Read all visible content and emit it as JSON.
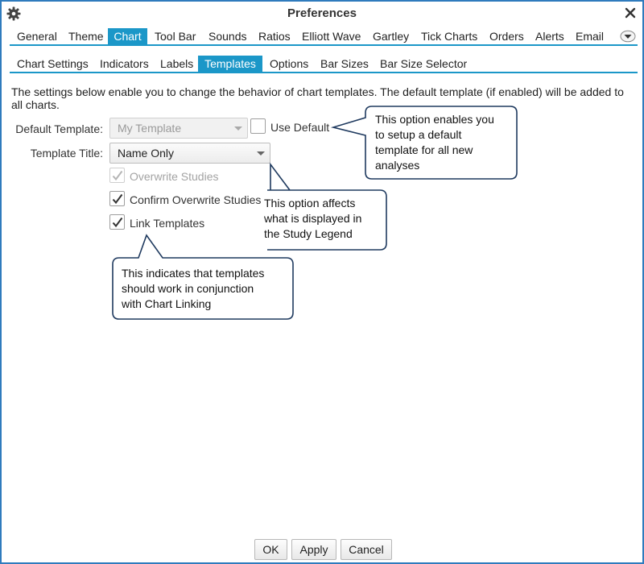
{
  "window": {
    "title": "Preferences"
  },
  "icons": {
    "settings": "gear-icon",
    "close": "close-icon",
    "more": "chevron-down-icon",
    "check": "check-icon"
  },
  "colors": {
    "accent": "#1b97c8",
    "border": "#2f7bbd",
    "callout_border": "#1f3a5f"
  },
  "main_tabs": [
    {
      "label": "General"
    },
    {
      "label": "Theme"
    },
    {
      "label": "Chart",
      "active": true
    },
    {
      "label": "Tool Bar"
    },
    {
      "label": "Sounds"
    },
    {
      "label": "Ratios"
    },
    {
      "label": "Elliott Wave"
    },
    {
      "label": "Gartley"
    },
    {
      "label": "Tick Charts"
    },
    {
      "label": "Orders"
    },
    {
      "label": "Alerts"
    },
    {
      "label": "Email"
    }
  ],
  "sub_tabs": [
    {
      "label": "Chart Settings"
    },
    {
      "label": "Indicators"
    },
    {
      "label": "Labels"
    },
    {
      "label": "Templates",
      "active": true
    },
    {
      "label": "Options"
    },
    {
      "label": "Bar Sizes"
    },
    {
      "label": "Bar Size Selector"
    }
  ],
  "description": {
    "line1": "The settings below enable you to change the behavior of chart templates.  The default template (if enabled) will be added to",
    "line2": "all charts."
  },
  "form": {
    "default_template_label": "Default Template:",
    "default_template_value": "My Template",
    "use_default_label": "Use Default",
    "use_default_checked": false,
    "template_title_label": "Template Title:",
    "template_title_value": "Name Only",
    "overwrite_studies_label": "Overwrite Studies",
    "overwrite_studies_checked": true,
    "confirm_overwrite_label": "Confirm Overwrite Studies",
    "confirm_overwrite_checked": true,
    "link_templates_label": "Link Templates",
    "link_templates_checked": true
  },
  "callouts": {
    "use_default": [
      "This option enables you",
      "to setup a default",
      "template for all new",
      "analyses"
    ],
    "template_title": [
      "This option affects",
      "what is displayed in",
      "the Study Legend"
    ],
    "link_templates": [
      "This indicates that templates",
      "should work in conjunction",
      "with Chart Linking"
    ]
  },
  "footer": {
    "ok": "OK",
    "apply": "Apply",
    "cancel": "Cancel"
  }
}
